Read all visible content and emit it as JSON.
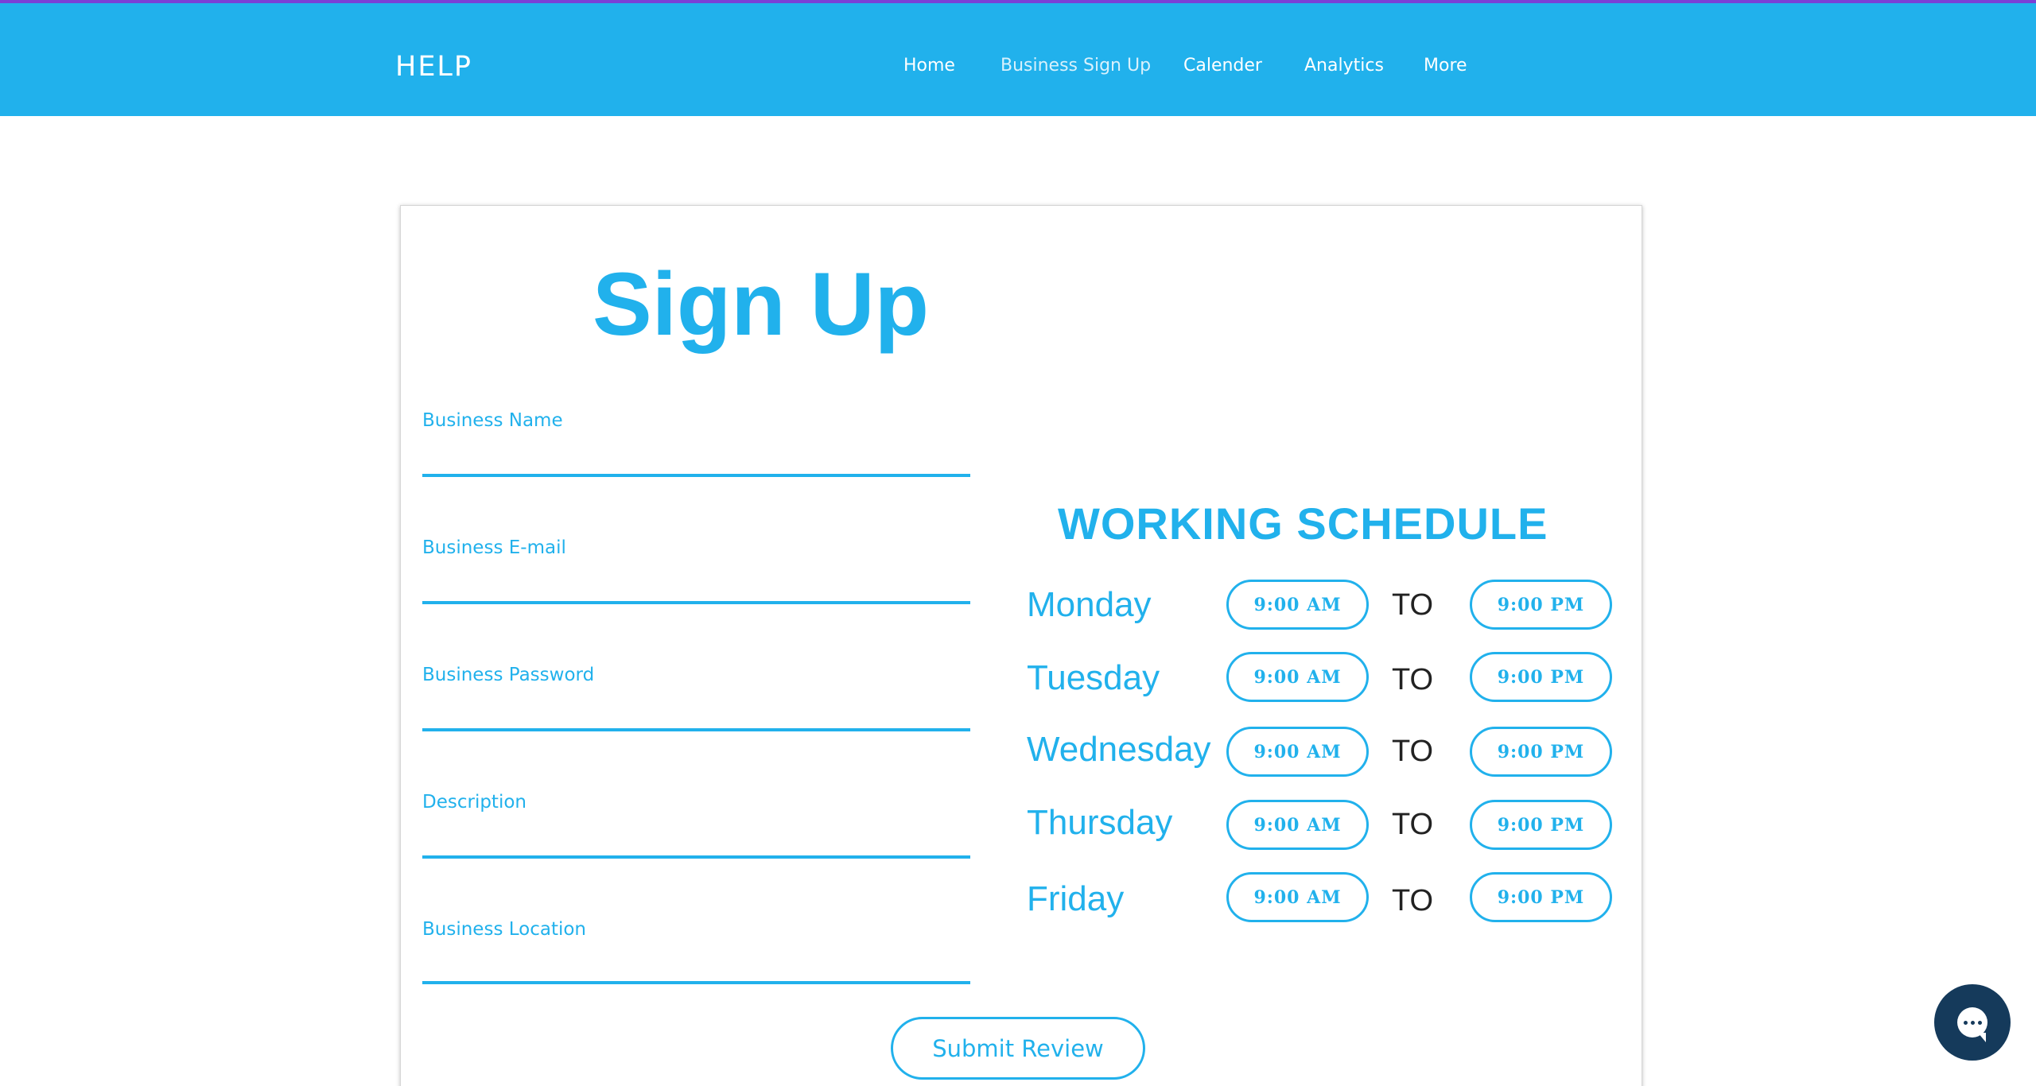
{
  "header": {
    "brand": "HELP",
    "nav": [
      {
        "label": "Home",
        "active": false
      },
      {
        "label": "Business Sign Up",
        "active": true
      },
      {
        "label": "Calender",
        "active": false
      },
      {
        "label": "Analytics",
        "active": false
      },
      {
        "label": "More",
        "active": false
      }
    ]
  },
  "form": {
    "title": "Sign Up",
    "fields": [
      {
        "label": "Business Name",
        "value": ""
      },
      {
        "label": "Business E-mail",
        "value": ""
      },
      {
        "label": "Business Password",
        "value": ""
      },
      {
        "label": "Description",
        "value": ""
      },
      {
        "label": "Business Location",
        "value": ""
      }
    ],
    "submit_label": "Submit Review"
  },
  "schedule": {
    "title": "WORKING SCHEDULE",
    "separator": "TO",
    "days": [
      {
        "day": "Monday",
        "start": "9:00 AM",
        "end": "9:00 PM"
      },
      {
        "day": "Tuesday",
        "start": "9:00 AM",
        "end": "9:00 PM"
      },
      {
        "day": "Wednesday",
        "start": "9:00 AM",
        "end": "9:00 PM"
      },
      {
        "day": "Thursday",
        "start": "9:00 AM",
        "end": "9:00 PM"
      },
      {
        "day": "Friday",
        "start": "9:00 AM",
        "end": "9:00 PM"
      }
    ]
  },
  "chat": {
    "icon": "chat-icon"
  },
  "colors": {
    "primary": "#21b1ec",
    "accent_bar": "#7b3fd6",
    "chat_button": "#153a5b",
    "text_dark": "#222222"
  }
}
